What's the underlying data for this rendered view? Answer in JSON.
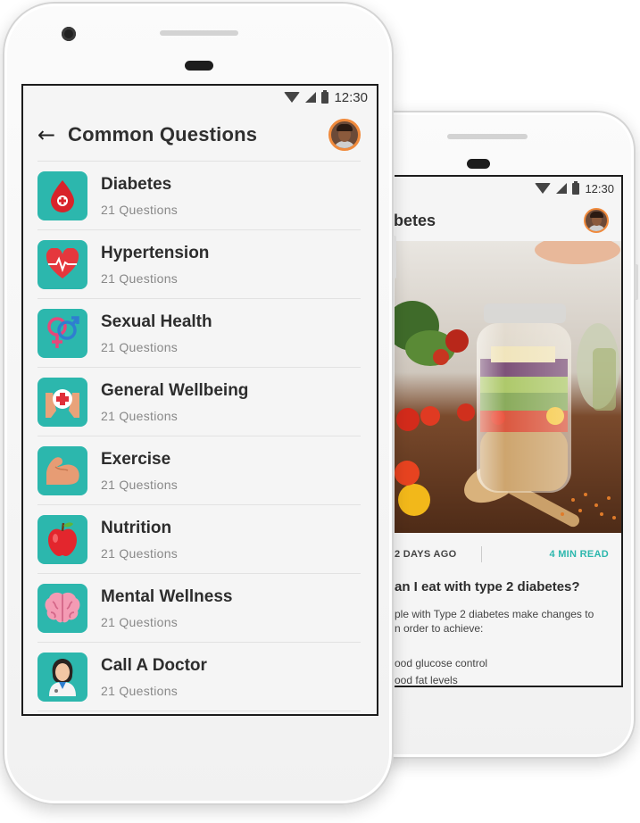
{
  "front": {
    "status": {
      "time": "12:30"
    },
    "header": {
      "title": "Common Questions"
    },
    "categories": [
      {
        "title": "Diabetes",
        "count": "21 Questions",
        "icon": "blood-drop-icon"
      },
      {
        "title": "Hypertension",
        "count": "21 Questions",
        "icon": "heart-pulse-icon"
      },
      {
        "title": "Sexual Health",
        "count": "21 Questions",
        "icon": "gender-symbols-icon"
      },
      {
        "title": "General Wellbeing",
        "count": "21 Questions",
        "icon": "medical-hands-icon"
      },
      {
        "title": "Exercise",
        "count": "21 Questions",
        "icon": "flexed-arm-icon"
      },
      {
        "title": "Nutrition",
        "count": "21 Questions",
        "icon": "apple-icon"
      },
      {
        "title": "Mental Wellness",
        "count": "21 Questions",
        "icon": "brain-icon"
      },
      {
        "title": "Call A Doctor",
        "count": "21 Questions",
        "icon": "doctor-icon"
      }
    ]
  },
  "back": {
    "status": {
      "time": "12:30"
    },
    "header": {
      "title": "betes"
    },
    "meta": {
      "age": "2 DAYS AGO",
      "read": "4 MIN READ"
    },
    "article": {
      "title": "an I eat with type 2 diabetes?",
      "body_1": "ple with Type 2 diabetes make changes to",
      "body_2": "n order to achieve:",
      "bullet_1": "ood glucose control",
      "bullet_2": "ood fat levels"
    }
  },
  "colors": {
    "accent": "#2cb7ad",
    "avatar_ring": "#f08a3c"
  }
}
